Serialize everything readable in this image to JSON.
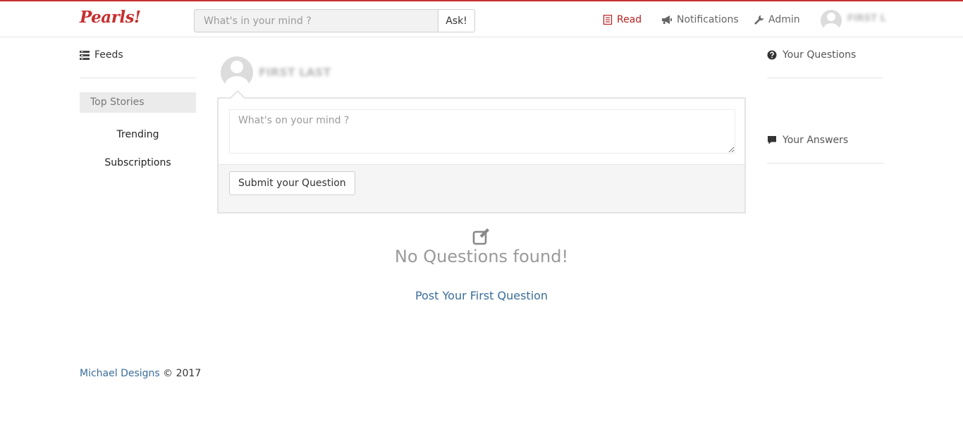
{
  "colors": {
    "brand": "#c62f2f",
    "active_nav": "#b52424",
    "link": "#3a6d9a"
  },
  "navbar": {
    "brand": "Pearls!",
    "search_placeholder": "What's in your mind ?",
    "ask_label": "Ask!",
    "items": [
      {
        "label": "Read",
        "icon": "book-icon",
        "active": true
      },
      {
        "label": "Notifications",
        "icon": "megaphone-icon",
        "active": false
      },
      {
        "label": "Admin",
        "icon": "wrench-icon",
        "active": false
      }
    ],
    "username": "FIRST L"
  },
  "left_sidebar": {
    "feeds_label": "Feeds",
    "top_stories": "Top Stories",
    "links": [
      "Trending",
      "Subscriptions"
    ]
  },
  "composer": {
    "username": "FIRST LAST",
    "placeholder": "What's on your mind ?",
    "submit_label": "Submit your Question"
  },
  "empty_state": {
    "icon": "edit-icon",
    "title": "No Questions found!",
    "link": "Post Your First Question"
  },
  "right_sidebar": {
    "questions_label": "Your Questions",
    "answers_label": "Your Answers"
  },
  "footer": {
    "author": "Michael Designs",
    "copyright": " © 2017"
  }
}
